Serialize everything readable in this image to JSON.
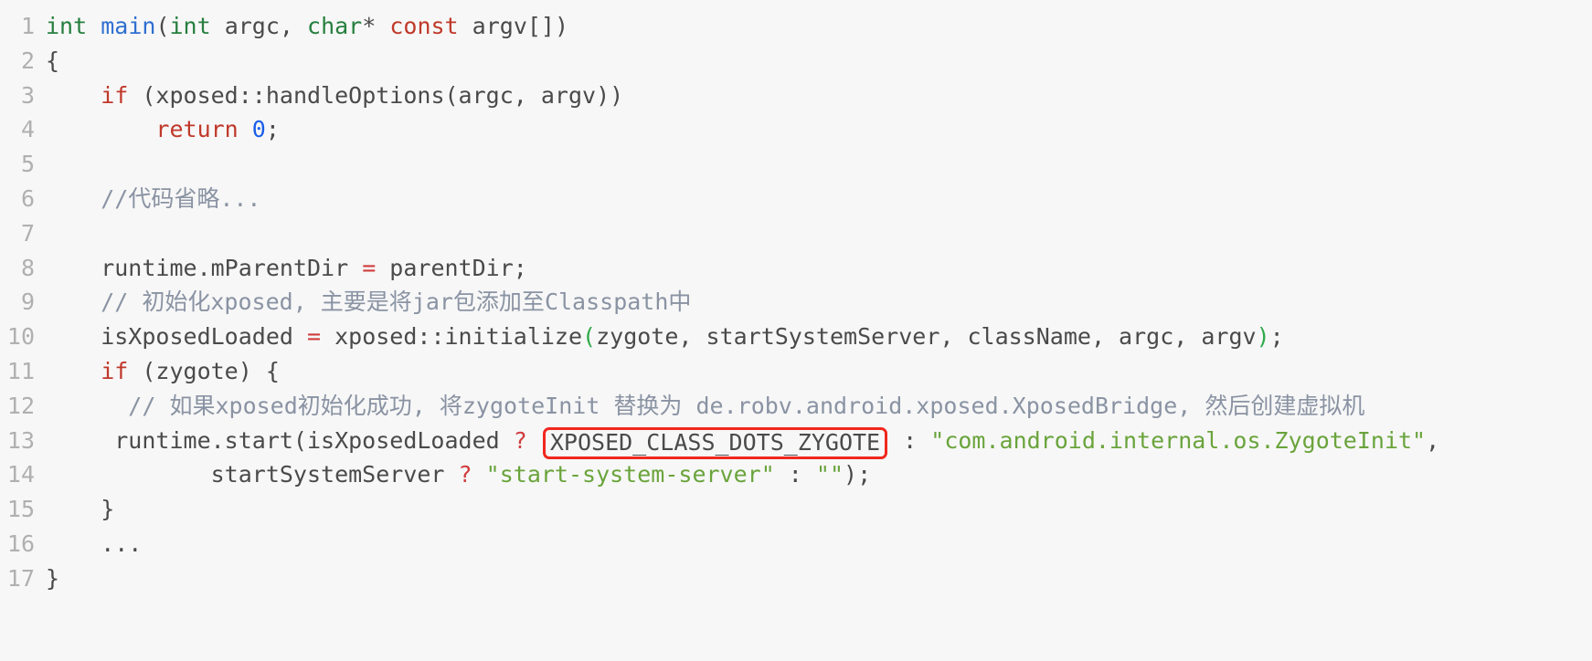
{
  "editor": {
    "language": "cpp",
    "background_color": "#f7f7f7",
    "gutter_color": "#b0b0b0",
    "text_color": "#4a4a4a",
    "highlight_box_color": "#f0281e",
    "theme_colors": {
      "keyword": "#c0392b",
      "type": "#267f3e",
      "function": "#2f6fd0",
      "number": "#1a5ee8",
      "comment": "#8a93a3",
      "string": "#6aa43c",
      "operator": "#d03c3c",
      "paren": "#2faa4a"
    }
  },
  "lines": [
    {
      "number": "1",
      "tokens": [
        {
          "t": "int",
          "c": "t-type"
        },
        {
          "t": " ",
          "c": "t-plain"
        },
        {
          "t": "main",
          "c": "t-func"
        },
        {
          "t": "(",
          "c": "t-plain"
        },
        {
          "t": "int",
          "c": "t-type"
        },
        {
          "t": " argc, ",
          "c": "t-plain"
        },
        {
          "t": "char",
          "c": "t-type"
        },
        {
          "t": "* ",
          "c": "t-plain"
        },
        {
          "t": "const",
          "c": "t-keyword"
        },
        {
          "t": " argv[])",
          "c": "t-plain"
        }
      ]
    },
    {
      "number": "2",
      "tokens": [
        {
          "t": "{",
          "c": "t-plain"
        }
      ]
    },
    {
      "number": "3",
      "tokens": [
        {
          "t": "    ",
          "c": "t-plain"
        },
        {
          "t": "if",
          "c": "t-keyword"
        },
        {
          "t": " (xposed::handleOptions(argc, argv))",
          "c": "t-plain"
        }
      ]
    },
    {
      "number": "4",
      "tokens": [
        {
          "t": "        ",
          "c": "t-plain"
        },
        {
          "t": "return",
          "c": "t-keyword"
        },
        {
          "t": " ",
          "c": "t-plain"
        },
        {
          "t": "0",
          "c": "t-number"
        },
        {
          "t": ";",
          "c": "t-plain"
        }
      ]
    },
    {
      "number": "5",
      "tokens": []
    },
    {
      "number": "6",
      "tokens": [
        {
          "t": "    ",
          "c": "t-plain"
        },
        {
          "t": "//代码省略...",
          "c": "t-comment"
        }
      ]
    },
    {
      "number": "7",
      "tokens": []
    },
    {
      "number": "8",
      "tokens": [
        {
          "t": "    runtime.mParentDir ",
          "c": "t-plain"
        },
        {
          "t": "=",
          "c": "t-op"
        },
        {
          "t": " parentDir;",
          "c": "t-plain"
        }
      ]
    },
    {
      "number": "9",
      "tokens": [
        {
          "t": "    ",
          "c": "t-plain"
        },
        {
          "t": "// 初始化xposed, 主要是将jar包添加至Classpath中",
          "c": "t-comment"
        }
      ]
    },
    {
      "number": "10",
      "tokens": [
        {
          "t": "    isXposedLoaded ",
          "c": "t-plain"
        },
        {
          "t": "=",
          "c": "t-op"
        },
        {
          "t": " xposed::initialize",
          "c": "t-plain"
        },
        {
          "t": "(",
          "c": "t-paren"
        },
        {
          "t": "zygote, startSystemServer, className, argc, argv",
          "c": "t-plain"
        },
        {
          "t": ")",
          "c": "t-paren"
        },
        {
          "t": ";",
          "c": "t-plain"
        }
      ]
    },
    {
      "number": "11",
      "tokens": [
        {
          "t": "    ",
          "c": "t-plain"
        },
        {
          "t": "if",
          "c": "t-keyword"
        },
        {
          "t": " (zygote) {",
          "c": "t-plain"
        }
      ]
    },
    {
      "number": "12",
      "tokens": [
        {
          "t": "      // 如果xposed初始化成功, 将zygoteInit 替换为 de.robv.android.xposed.XposedBridge, 然后创建虚拟机",
          "c": "t-comment"
        }
      ]
    },
    {
      "number": "13",
      "tokens": [
        {
          "t": "     runtime.start(isXposedLoaded ",
          "c": "t-plain"
        },
        {
          "t": "?",
          "c": "t-op"
        },
        {
          "t": " ",
          "c": "t-plain"
        },
        {
          "t": "XPOSED_CLASS_DOTS_ZYGOTE",
          "c": "t-boxed",
          "boxed": true
        },
        {
          "t": " : ",
          "c": "t-plain"
        },
        {
          "t": "\"com.android.internal.os.ZygoteInit\"",
          "c": "t-string"
        },
        {
          "t": ",",
          "c": "t-plain"
        }
      ]
    },
    {
      "number": "14",
      "tokens": [
        {
          "t": "            startSystemServer ",
          "c": "t-plain"
        },
        {
          "t": "?",
          "c": "t-op"
        },
        {
          "t": " ",
          "c": "t-plain"
        },
        {
          "t": "\"start-system-server\"",
          "c": "t-string"
        },
        {
          "t": " : ",
          "c": "t-plain"
        },
        {
          "t": "\"\"",
          "c": "t-string"
        },
        {
          "t": ");",
          "c": "t-plain"
        }
      ]
    },
    {
      "number": "15",
      "tokens": [
        {
          "t": "    }",
          "c": "t-plain"
        }
      ]
    },
    {
      "number": "16",
      "tokens": [
        {
          "t": "    ...",
          "c": "t-plain"
        }
      ]
    },
    {
      "number": "17",
      "tokens": [
        {
          "t": "}",
          "c": "t-plain"
        }
      ]
    }
  ]
}
